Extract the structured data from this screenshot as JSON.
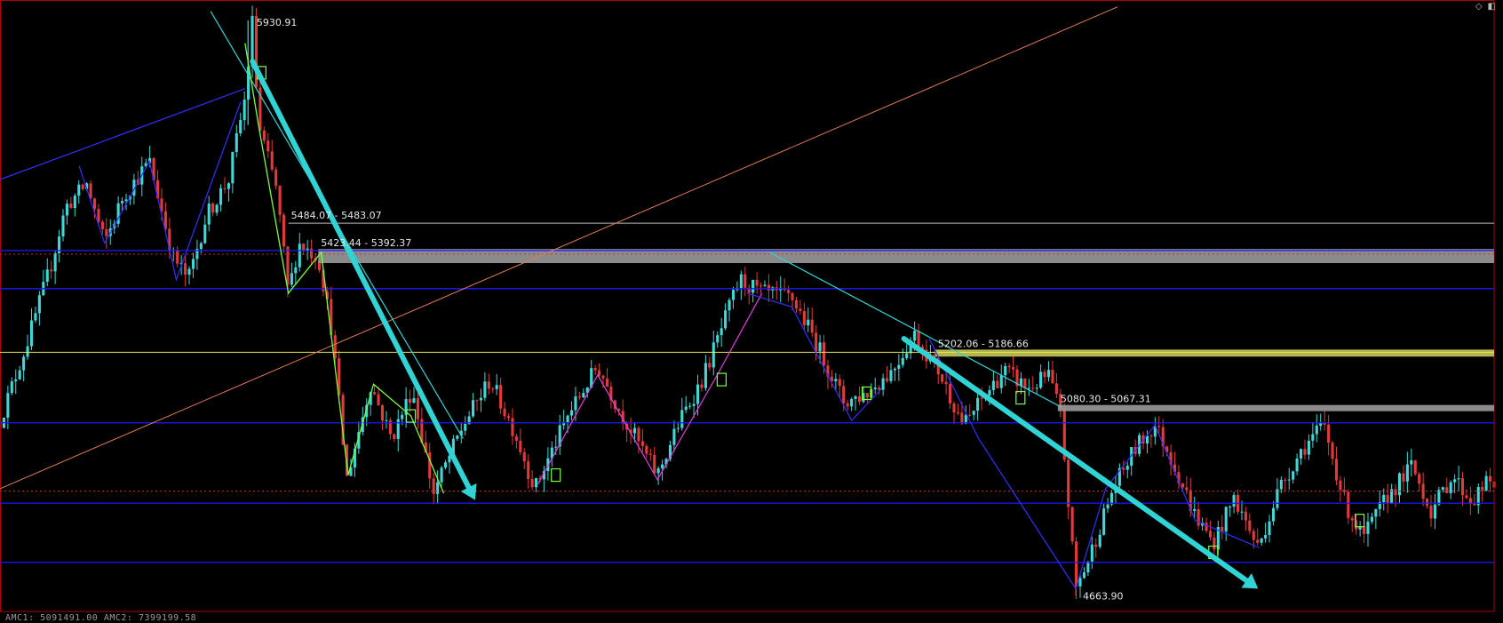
{
  "window": {
    "diamond_icon": "diamond-icon",
    "panel_icon": "panel-toggle-icon"
  },
  "footer": {
    "indicator_text": "AMC1: 5091491.00 AMC2: 7399199.58"
  },
  "colors": {
    "background": "#000000",
    "frame": "#b00000",
    "bull": "#3fd8d8",
    "bear": "#e23a3a",
    "support": "#1a1aff",
    "zone_gray": "#9a9a9a",
    "zone_yellow": "#c8c85a",
    "yellow_line": "#e8e850",
    "trend_orange": "#e07a55",
    "trend_cyan": "#30d4d4",
    "zigzag_green": "#7aff3a",
    "zigzag_magenta": "#e040e0",
    "zigzag_blue": "#3030ff"
  },
  "chart_data": {
    "type": "candlestick",
    "title": "",
    "xlabel": "",
    "ylabel": "",
    "ylim": [
      4630,
      5975
    ],
    "grid": false,
    "price_labels": {
      "high": "5930.91",
      "low": "4663.90"
    },
    "zones": [
      {
        "label": "5484.07 - 5483.07",
        "top": 5484.07,
        "bottom": 5483.07,
        "color": "gray",
        "from_x": 0.193
      },
      {
        "label": "5423.44 - 5392.37",
        "top": 5423.44,
        "bottom": 5392.37,
        "color": "gray",
        "from_x": 0.213
      },
      {
        "label": "5202.06 - 5186.66",
        "top": 5202.06,
        "bottom": 5186.66,
        "color": "yellow",
        "from_x": 0.626
      },
      {
        "label": "5080.30 - 5067.31",
        "top": 5080.3,
        "bottom": 5067.31,
        "color": "gray",
        "from_x": 0.708
      }
    ],
    "horizontal_levels": [
      {
        "price": 5424,
        "color": "blue"
      },
      {
        "price": 5340,
        "color": "blue"
      },
      {
        "price": 5200,
        "color": "yellow"
      },
      {
        "price": 5045,
        "color": "blue"
      },
      {
        "price": 4868,
        "color": "blue"
      },
      {
        "price": 4738,
        "color": "blue"
      },
      {
        "price": 5416,
        "color": "red-dotted"
      },
      {
        "price": 4895,
        "color": "red-dotted"
      }
    ],
    "pivots": [
      [
        0.0,
        5050
      ],
      [
        0.018,
        5220
      ],
      [
        0.034,
        5390
      ],
      [
        0.044,
        5520
      ],
      [
        0.058,
        5570
      ],
      [
        0.07,
        5440
      ],
      [
        0.082,
        5540
      ],
      [
        0.1,
        5620
      ],
      [
        0.116,
        5410
      ],
      [
        0.126,
        5360
      ],
      [
        0.138,
        5500
      ],
      [
        0.153,
        5580
      ],
      [
        0.164,
        5760
      ],
      [
        0.169,
        5930
      ],
      [
        0.173,
        5700
      ],
      [
        0.185,
        5560
      ],
      [
        0.193,
        5330
      ],
      [
        0.2,
        5440
      ],
      [
        0.213,
        5410
      ],
      [
        0.222,
        5250
      ],
      [
        0.232,
        4920
      ],
      [
        0.248,
        5130
      ],
      [
        0.262,
        5010
      ],
      [
        0.276,
        5120
      ],
      [
        0.29,
        4890
      ],
      [
        0.31,
        5040
      ],
      [
        0.328,
        5140
      ],
      [
        0.345,
        5020
      ],
      [
        0.358,
        4900
      ],
      [
        0.38,
        5060
      ],
      [
        0.4,
        5170
      ],
      [
        0.415,
        5070
      ],
      [
        0.44,
        4930
      ],
      [
        0.455,
        5050
      ],
      [
        0.47,
        5140
      ],
      [
        0.485,
        5270
      ],
      [
        0.495,
        5360
      ],
      [
        0.51,
        5330
      ],
      [
        0.53,
        5320
      ],
      [
        0.545,
        5230
      ],
      [
        0.565,
        5090
      ],
      [
        0.58,
        5110
      ],
      [
        0.597,
        5160
      ],
      [
        0.612,
        5240
      ],
      [
        0.628,
        5160
      ],
      [
        0.645,
        5040
      ],
      [
        0.658,
        5100
      ],
      [
        0.672,
        5160
      ],
      [
        0.688,
        5120
      ],
      [
        0.702,
        5150
      ],
      [
        0.71,
        5060
      ],
      [
        0.72,
        4680
      ],
      [
        0.728,
        4740
      ],
      [
        0.745,
        4900
      ],
      [
        0.76,
        4990
      ],
      [
        0.773,
        5040
      ],
      [
        0.785,
        4960
      ],
      [
        0.8,
        4840
      ],
      [
        0.812,
        4780
      ],
      [
        0.826,
        4880
      ],
      [
        0.842,
        4770
      ],
      [
        0.856,
        4900
      ],
      [
        0.872,
        4990
      ],
      [
        0.886,
        5040
      ],
      [
        0.9,
        4870
      ],
      [
        0.912,
        4790
      ],
      [
        0.928,
        4880
      ],
      [
        0.945,
        4950
      ],
      [
        0.958,
        4850
      ],
      [
        0.972,
        4930
      ],
      [
        0.985,
        4870
      ],
      [
        0.994,
        4910
      ]
    ]
  }
}
